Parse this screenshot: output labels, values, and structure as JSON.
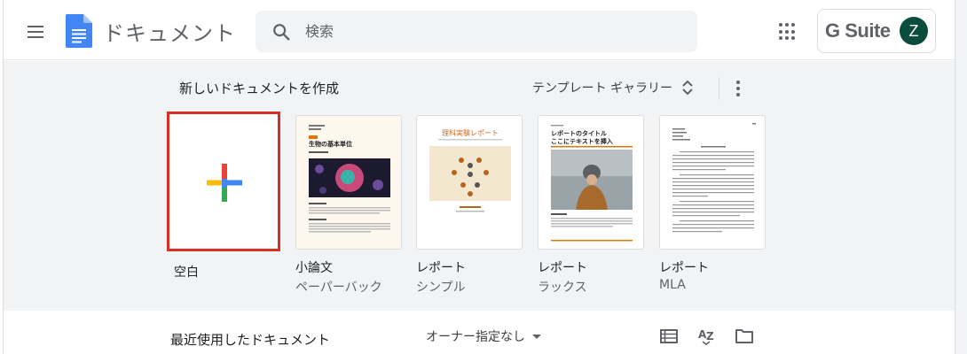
{
  "header": {
    "app_title": "ドキュメント",
    "search_placeholder": "検索",
    "brand": "G Suite",
    "avatar_initial": "Z"
  },
  "gallery": {
    "title": "新しいドキュメントを作成",
    "toggle_label": "テンプレート ギャラリー",
    "templates": [
      {
        "label": "空白",
        "sub": ""
      },
      {
        "label": "小論文",
        "sub": "ペーパーバック"
      },
      {
        "label": "レポート",
        "sub": "シンプル"
      },
      {
        "label": "レポート",
        "sub": "ラックス"
      },
      {
        "label": "レポート",
        "sub": "MLA"
      }
    ],
    "thumbs": {
      "essay_title": "生物の基本単位",
      "report_title": "理科実験レポート",
      "lux_title": "レポートのタイトル\nここにテキストを挿入"
    }
  },
  "recent": {
    "title": "最近使用したドキュメント",
    "owner_filter": "オーナー指定なし"
  },
  "colors": {
    "accent_blue": "#4285f4",
    "accent_red": "#ea4335",
    "accent_yellow": "#fbbc04",
    "accent_green": "#34a853",
    "selection_red": "#d93025",
    "avatar_bg": "#0b4d3c"
  },
  "icons": {
    "menu": "hamburger-icon",
    "search": "search-icon",
    "apps": "apps-grid-icon",
    "more": "more-vert-icon",
    "list": "list-view-icon",
    "sort": "sort-az-icon",
    "folder": "folder-icon"
  }
}
